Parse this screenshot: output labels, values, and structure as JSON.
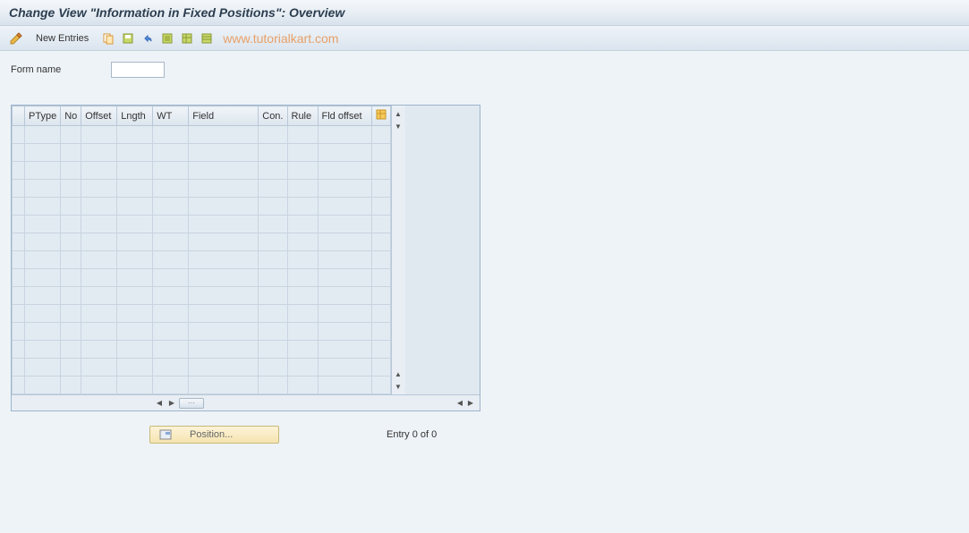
{
  "title": "Change View \"Information in Fixed Positions\": Overview",
  "toolbar": {
    "new_entries": "New Entries"
  },
  "watermark": "www.tutorialkart.com",
  "form": {
    "name_label": "Form name",
    "name_value": ""
  },
  "table": {
    "headers": {
      "ptype": "PType",
      "no": "No",
      "offset": "Offset",
      "lngth": "Lngth",
      "wt": "WT",
      "field": "Field",
      "con": "Con.",
      "rule": "Rule",
      "fld_offset": "Fld offset"
    },
    "row_count": 15
  },
  "position_button": "Position...",
  "entry_status": "Entry 0 of 0",
  "icons": {
    "pencil": "pencil-icon",
    "copy": "copy-icon",
    "save": "save-icon",
    "undo": "undo-icon",
    "select_all": "select-all-icon",
    "table_settings1": "table-settings-icon",
    "table_settings2": "table-config-icon"
  }
}
